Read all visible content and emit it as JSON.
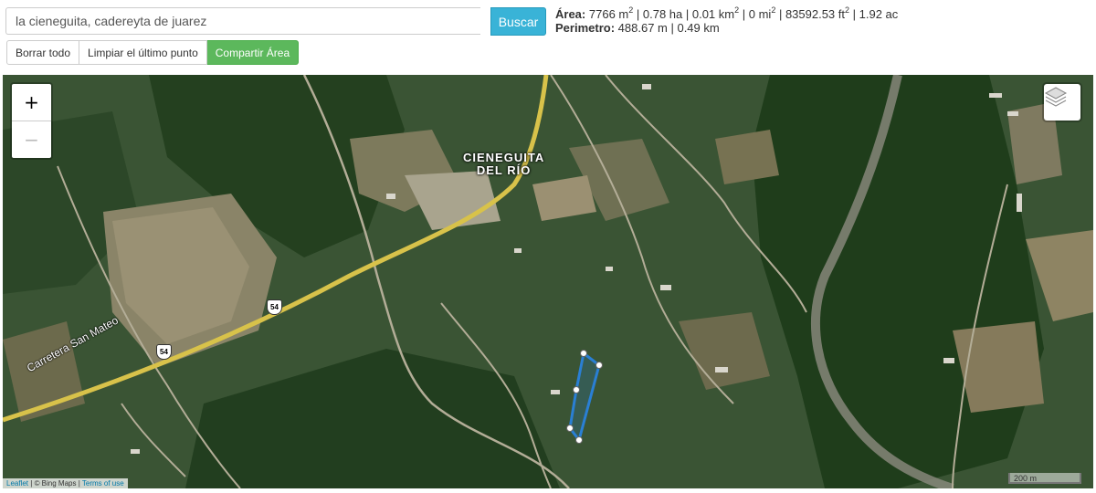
{
  "search": {
    "value": "la cieneguita, cadereyta de juarez",
    "button_label": "Buscar"
  },
  "toolbar": {
    "clear_all": "Borrar todo",
    "clear_last": "Limpiar el último punto",
    "share": "Compartir Área"
  },
  "measurements": {
    "area_label": "Área:",
    "area_m2": "7766 m",
    "area_ha": "| 0.78 ha | 0.01 km",
    "area_mi2": "| 0 mi",
    "area_ft2": "| 83592.53 ft",
    "area_ac": "| 1.92 ac",
    "sq": "2",
    "perimeter_label": "Perimetro:",
    "perimeter_value": "488.67 m | 0.49 km"
  },
  "map": {
    "zoom_in": "+",
    "zoom_out": "−",
    "place_name_line1": "CIENEGUITA",
    "place_name_line2": "DEL RÍO",
    "road_name": "Carretera San Mateo",
    "highway_number": "54",
    "attribution_leaflet": "Leaflet",
    "attribution_bing": "© Bing Maps",
    "attribution_terms": "Terms of use",
    "scale_label": "200 m",
    "polygon_color": "#2a7fd4",
    "road_color": "#d8c24a"
  }
}
